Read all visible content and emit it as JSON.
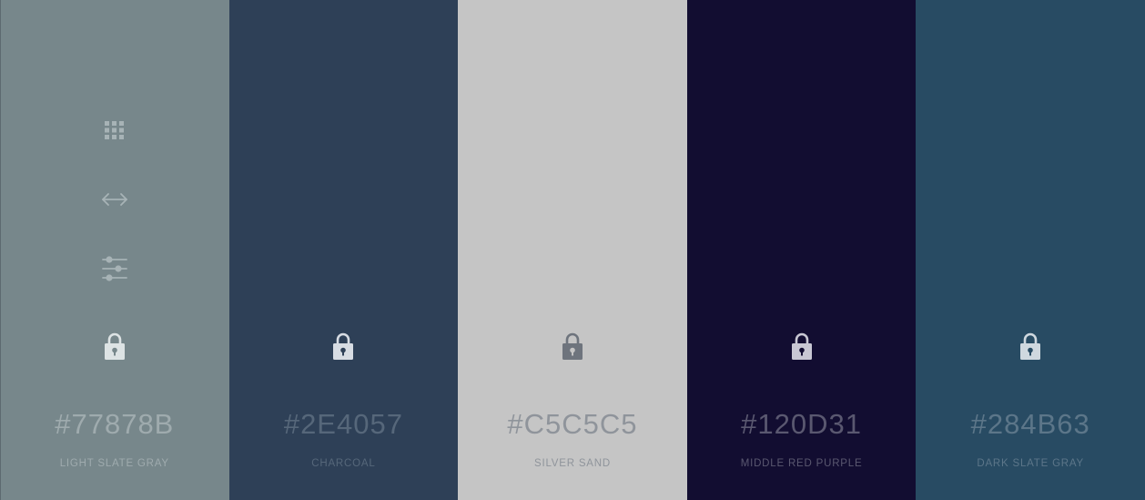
{
  "swatches": [
    {
      "hex": "#77878B",
      "name": "LIGHT SLATE GRAY",
      "bg": "#77878B",
      "text_color": "#9fabae",
      "icon_color": "#dde3e4",
      "show_tools": true
    },
    {
      "hex": "#2E4057",
      "name": "CHARCOAL",
      "bg": "#2E4057",
      "text_color": "#56677a",
      "icon_color": "#d7dce3",
      "show_tools": false
    },
    {
      "hex": "#C5C5C5",
      "name": "SILVER SAND",
      "bg": "#C5C5C5",
      "text_color": "#8f949b",
      "icon_color": "#6e747d",
      "show_tools": false
    },
    {
      "hex": "#120D31",
      "name": "MIDDLE RED PURPLE",
      "bg": "#120D31",
      "text_color": "#5a5870",
      "icon_color": "#c8c7d3",
      "show_tools": false
    },
    {
      "hex": "#284B63",
      "name": "DARK SLATE GRAY",
      "bg": "#284B63",
      "text_color": "#5c7689",
      "icon_color": "#cfd8df",
      "show_tools": false
    }
  ],
  "tools": {
    "icons": [
      "grid-icon",
      "arrows-horizontal-icon",
      "sliders-icon"
    ],
    "tool_color": "#a7b3b6"
  },
  "lock_icon": "lock-icon"
}
